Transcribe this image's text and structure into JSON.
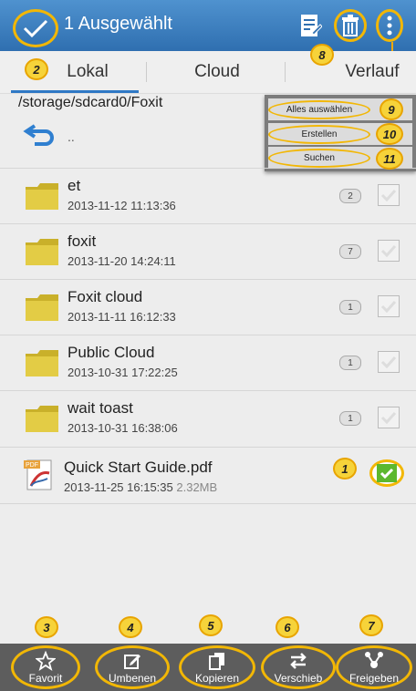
{
  "topbar": {
    "title": "1 Ausgewählt",
    "icons": [
      "checkmark-icon",
      "document-edit-icon",
      "trash-icon",
      "overflow-menu-icon"
    ],
    "colors": {
      "bar": "#2f6fb0",
      "highlight": "#f2b705"
    }
  },
  "tabs": [
    {
      "label": "Lokal"
    },
    {
      "label": "Cloud"
    },
    {
      "label": "Verlauf"
    }
  ],
  "path": "/storage/sdcard0/Foxit",
  "back_label": "..",
  "menu": {
    "items": [
      {
        "label": "Alles auswählen"
      },
      {
        "label": "Erstellen"
      },
      {
        "label": "Suchen"
      }
    ]
  },
  "files": [
    {
      "name": "et",
      "date": "2013-11-12 11:13:36",
      "count": "2",
      "type": "folder",
      "checked": false
    },
    {
      "name": "foxit",
      "date": "2013-11-20 14:24:11",
      "count": "7",
      "type": "folder",
      "checked": false
    },
    {
      "name": "Foxit cloud",
      "date": "2013-11-11 16:12:33",
      "count": "1",
      "type": "folder",
      "checked": false
    },
    {
      "name": "Public Cloud",
      "date": "2013-10-31 17:22:25",
      "count": "1",
      "type": "folder",
      "checked": false
    },
    {
      "name": "wait toast",
      "date": "2013-10-31 16:38:06",
      "count": "1",
      "type": "folder",
      "checked": false
    },
    {
      "name": "Quick Start Guide.pdf",
      "date": "2013-11-25 16:15:35",
      "size": "2.32MB",
      "type": "pdf",
      "checked": true
    }
  ],
  "bottom": [
    {
      "label": "Favorit",
      "icon": "star-icon"
    },
    {
      "label": "Umbenen",
      "icon": "rename-icon"
    },
    {
      "label": "Kopieren",
      "icon": "copy-icon"
    },
    {
      "label": "Verschieb",
      "icon": "move-icon"
    },
    {
      "label": "Freigeben",
      "icon": "share-icon"
    }
  ],
  "callouts": [
    "1",
    "2",
    "3",
    "4",
    "5",
    "6",
    "7",
    "8",
    "9",
    "10",
    "11"
  ]
}
